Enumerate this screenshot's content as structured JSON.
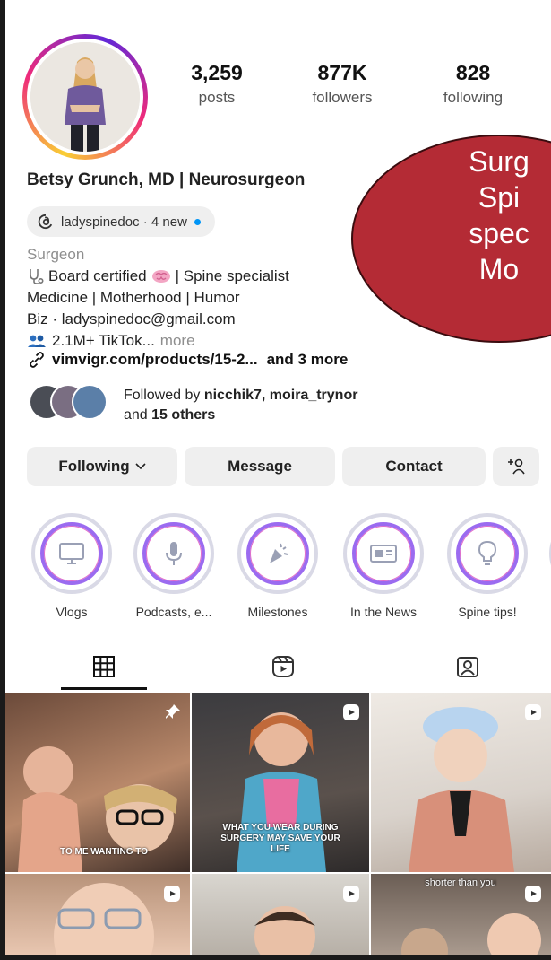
{
  "profile": {
    "name": "Betsy Grunch, MD | Neurosurgeon",
    "stats": [
      {
        "value": "3,259",
        "label": "posts"
      },
      {
        "value": "877K",
        "label": "followers"
      },
      {
        "value": "828",
        "label": "following"
      }
    ],
    "threads_badge": "ladyspinedoc · 4 new",
    "category": "Surgeon",
    "bio_lines": [
      "Board certified",
      "| Spine specialist",
      "Medicine | Motherhood | Humor",
      "Biz · ladyspinedoc@gmail.com",
      "2.1M+ TikTok...",
      "more"
    ],
    "link": "vimvigr.com/products/15-2...",
    "link_more": "and 3 more",
    "followed_by": {
      "prefix": "Followed by",
      "names": "nicchik7, moira_trynor",
      "and": "and",
      "others": "15 others"
    }
  },
  "actions": {
    "following": "Following",
    "message": "Message",
    "contact": "Contact"
  },
  "highlights": [
    "Vlogs",
    "Podcasts, e...",
    "Milestones",
    "In the News",
    "Spine tips!"
  ],
  "posts": {
    "captions": [
      "TO ME WANTING TO",
      "WHAT YOU WEAR DURING SURGERY MAY SAVE YOUR LIFE",
      "",
      "",
      "",
      "shorter than you"
    ]
  },
  "overlay": {
    "lines": [
      "Surg",
      "Spi",
      "spec",
      "Mo"
    ]
  },
  "colors": {
    "overlay_fill": "#b42b35",
    "story_ring": "#ee2a7b",
    "badge_dot": "#0095f6"
  }
}
